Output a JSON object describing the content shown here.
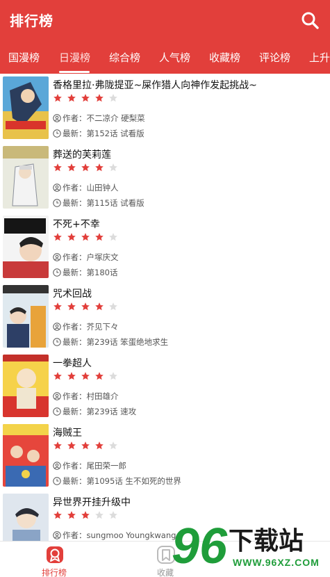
{
  "header": {
    "title": "排行榜",
    "icon": "search-icon"
  },
  "tabs": [
    {
      "label": "国漫榜",
      "active": false
    },
    {
      "label": "日漫榜",
      "active": true
    },
    {
      "label": "综合榜",
      "active": false
    },
    {
      "label": "人气榜",
      "active": false
    },
    {
      "label": "收藏榜",
      "active": false
    },
    {
      "label": "评论榜",
      "active": false
    },
    {
      "label": "上升",
      "active": false
    }
  ],
  "labels": {
    "author_prefix": "作者：",
    "latest_prefix": "最新："
  },
  "items": [
    {
      "title": "香格里拉·弗陇提亚~屎作猎人向神作发起挑战~",
      "author": "不二凉介 硬梨菜",
      "latest": "第152话 试看版",
      "rating": 4
    },
    {
      "title": "葬送的芙莉莲",
      "author": "山田钟人",
      "latest": "第115话 试看版",
      "rating": 4
    },
    {
      "title": "不死+不幸",
      "author": "户塚庆文",
      "latest": "第180话",
      "rating": 4
    },
    {
      "title": "咒术回战",
      "author": "芥见下々",
      "latest": "第239话 笨蛋绝地求生",
      "rating": 4
    },
    {
      "title": "一拳超人",
      "author": "村田雄介",
      "latest": "第239话 速攻",
      "rating": 4
    },
    {
      "title": "海贼王",
      "author": "尾田荣一郎",
      "latest": "第1095话 生不如死的世界",
      "rating": 4
    },
    {
      "title": "异世界开挂升级中",
      "author": "sungmoo Youngkwang",
      "latest": "",
      "rating": 3
    }
  ],
  "bottom_nav": [
    {
      "label": "排行榜",
      "active": true,
      "icon": "rank-icon"
    },
    {
      "label": "收藏",
      "active": false,
      "icon": "favorite-icon"
    }
  ],
  "watermark": {
    "number": "96",
    "text": "下载站",
    "url": "WWW.96XZ.COM"
  },
  "colors": {
    "primary": "#e23f3b",
    "star_on": "#e23f3b",
    "star_off": "#dcdcdc"
  }
}
